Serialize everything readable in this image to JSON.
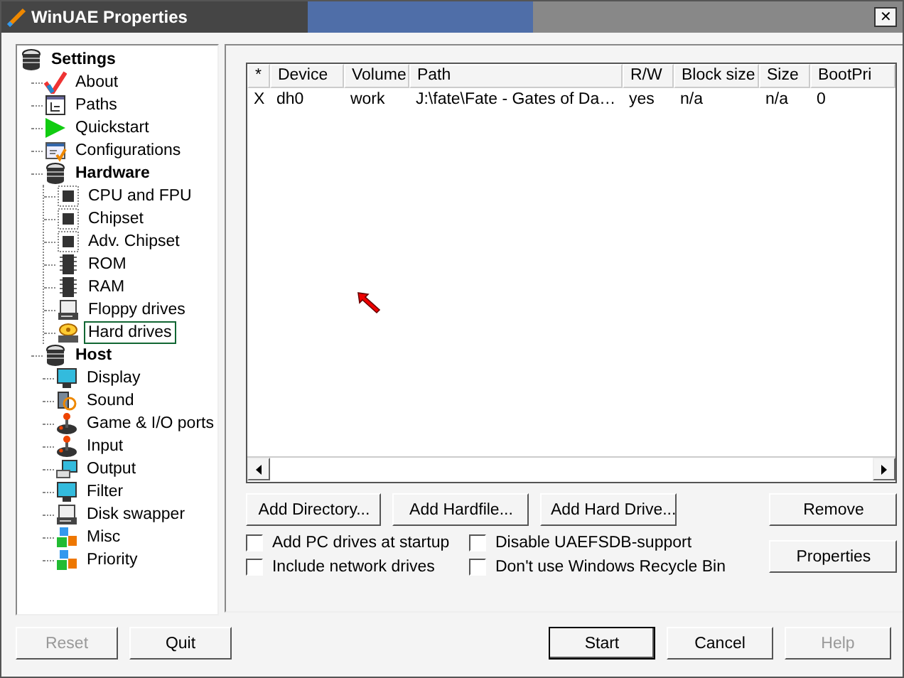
{
  "window": {
    "title": "WinUAE Properties",
    "close": "✕"
  },
  "tree": [
    {
      "label": "Settings",
      "selected": false,
      "children": [
        {
          "label": "About",
          "selected": false
        },
        {
          "label": "Paths",
          "selected": false
        },
        {
          "label": "Quickstart",
          "selected": false
        },
        {
          "label": "Configurations",
          "selected": false
        },
        {
          "label": "Hardware",
          "selected": false,
          "children": [
            {
              "label": "CPU and FPU",
              "selected": false
            },
            {
              "label": "Chipset",
              "selected": false
            },
            {
              "label": "Adv. Chipset",
              "selected": false
            },
            {
              "label": "ROM",
              "selected": false
            },
            {
              "label": "RAM",
              "selected": false
            },
            {
              "label": "Floppy drives",
              "selected": false
            },
            {
              "label": "Hard drives",
              "selected": true
            }
          ]
        },
        {
          "label": "Host",
          "selected": false,
          "children": [
            {
              "label": "Display",
              "selected": false
            },
            {
              "label": "Sound",
              "selected": false
            },
            {
              "label": "Game & I/O ports",
              "selected": false
            },
            {
              "label": "Input",
              "selected": false
            },
            {
              "label": "Output",
              "selected": false
            },
            {
              "label": "Filter",
              "selected": false
            },
            {
              "label": "Disk swapper",
              "selected": false
            },
            {
              "label": "Misc",
              "selected": false
            },
            {
              "label": "Priority",
              "selected": false
            }
          ]
        }
      ]
    }
  ],
  "table": {
    "columns": [
      "*",
      "Device",
      "Volume",
      "Path",
      "R/W",
      "Block size",
      "Size",
      "BootPri"
    ],
    "rows": [
      {
        "cells": [
          "X",
          "dh0",
          "work",
          "J:\\fate\\Fate - Gates of Da…",
          "yes",
          "n/a",
          "n/a",
          "0"
        ],
        "selected": false
      }
    ]
  },
  "actions": [
    {
      "label": "Add Directory...",
      "disabled": false
    },
    {
      "label": "Add Hardfile...",
      "disabled": false
    },
    {
      "label": "Add Hard Drive...",
      "disabled": false
    },
    {
      "label": "Remove",
      "disabled": false
    }
  ],
  "options": [
    {
      "label": "Add PC drives at startup",
      "checked": false
    },
    {
      "label": "Disable UAEFSDB-support",
      "checked": false
    },
    {
      "label": "Include network drives",
      "checked": false
    },
    {
      "label": "Don't use Windows Recycle Bin",
      "checked": false
    }
  ],
  "properties_button": {
    "label": "Properties",
    "disabled": false
  },
  "footer_left": [
    {
      "label": "Reset",
      "disabled": true,
      "default": false
    },
    {
      "label": "Quit",
      "disabled": false,
      "default": false
    }
  ],
  "footer_right": [
    {
      "label": "Start",
      "disabled": false,
      "default": true
    },
    {
      "label": "Cancel",
      "disabled": false,
      "default": false
    },
    {
      "label": "Help",
      "disabled": true,
      "default": false
    }
  ]
}
